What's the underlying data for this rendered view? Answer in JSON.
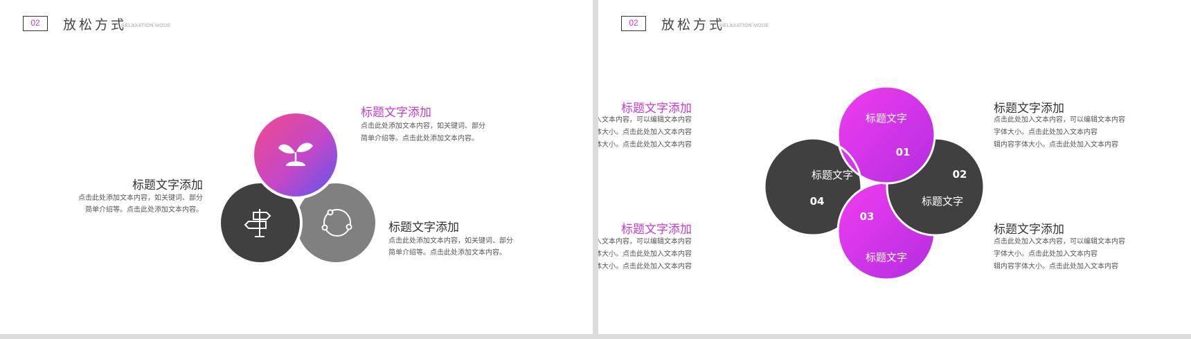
{
  "slides": [
    {
      "badge": "02",
      "title": "放松方式",
      "subtitle": "RELAXATION MODE",
      "items": [
        {
          "title": "标题文字添加",
          "line1": "点击此处添加文本内容，如关键词、部分",
          "line2": "简单介绍等。点击此处添加文本内容。"
        },
        {
          "title": "标题文字添加",
          "line1": "点击此处添加文本内容，如关键词、部分",
          "line2": "简单介绍等。点击此处添加文本内容。"
        },
        {
          "title": "标题文字添加",
          "line1": "点击此处添加文本内容，如关键词、部分",
          "line2": "简单介绍等。点击此处添加文本内容。"
        }
      ],
      "icons": [
        "sprout-icon",
        "signpost-icon",
        "share-icon"
      ]
    },
    {
      "badge": "02",
      "title": "放松方式",
      "subtitle": "RELAXATION MODE",
      "items": [
        {
          "title": "标题文字添加",
          "line1": "点击此处加入文本内容，可以编辑文本内容",
          "line2": "字体大小。点击此处加入文本内容",
          "line3": "辑内容字体大小。点击此处加入文本内容"
        },
        {
          "title": "标题文字添加",
          "line1": "点击此处加入文本内容，可以编辑文本内容",
          "line2": "字体大小。点击此处加入文本内容",
          "line3": "辑内容字体大小。点击此处加入文本内容"
        },
        {
          "title": "标题文字添加",
          "line1": "点击此处加入文本内容，可以编辑文本内容",
          "line2": "字体大小。点击此处加入文本内容",
          "line3": "辑内容字体大小。点击此处加入文本内容"
        },
        {
          "title": "标题文字添加",
          "line1": "点击此处加入文本内容，可以编辑文本内容",
          "line2": "字体大小。点击此处加入文本内容",
          "line3": "辑内容字体大小。点击此处加入文本内容"
        }
      ],
      "circles": [
        {
          "label": "标题文字",
          "num": "01"
        },
        {
          "label": "标题文字",
          "num": "02"
        },
        {
          "label": "标题文字",
          "num": "03"
        },
        {
          "label": "标题文字",
          "num": "04"
        }
      ]
    }
  ],
  "colors": {
    "pink": "#c93ad0",
    "magenta": "#e02cf0",
    "dark": "#404040",
    "gray": "#808080"
  }
}
